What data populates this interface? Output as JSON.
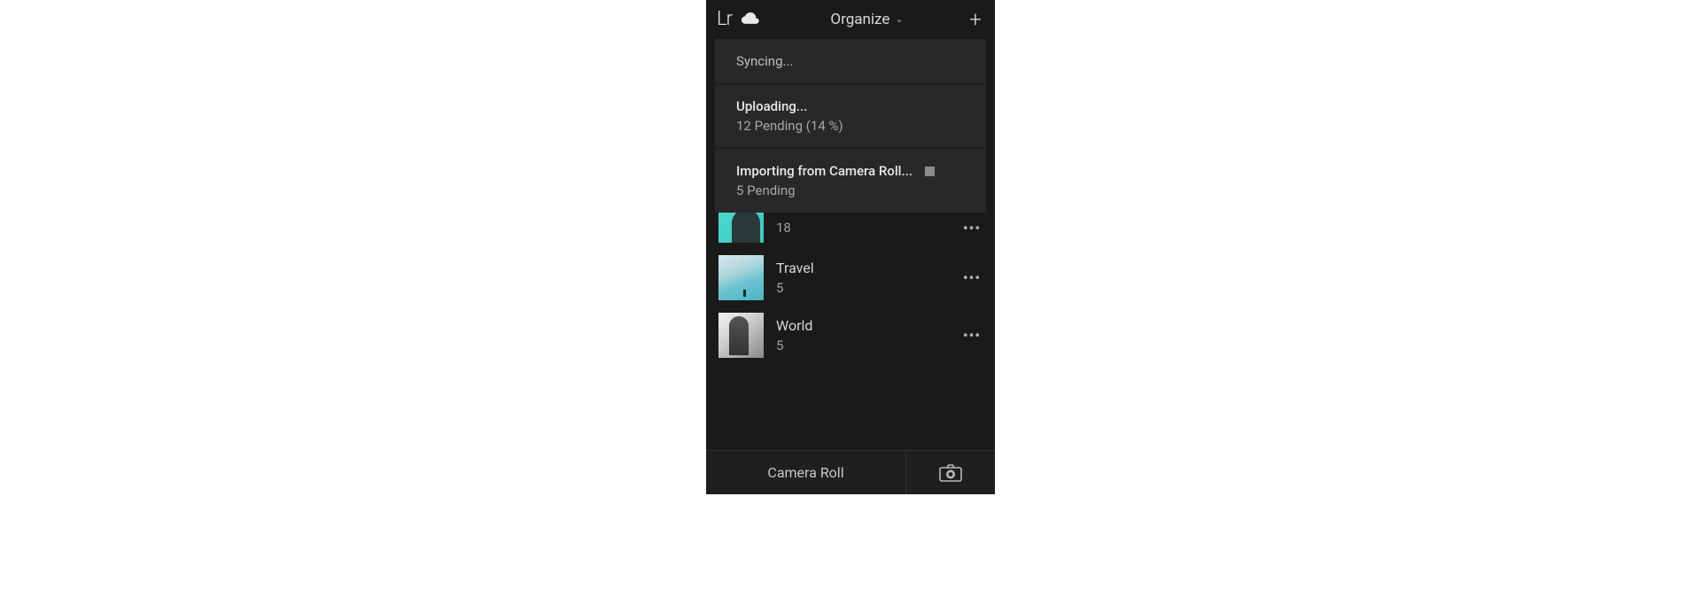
{
  "topbar": {
    "logo_text": "Lr",
    "title": "Organize",
    "plus_label": "+"
  },
  "sync_panel": {
    "syncing_label": "Syncing...",
    "uploading_label": "Uploading...",
    "uploading_sub": "12 Pending  (14 %)",
    "importing_label": "Importing from Camera Roll...",
    "importing_sub": "5 Pending"
  },
  "albums": [
    {
      "name": "",
      "count": "18"
    },
    {
      "name": "Travel",
      "count": "5"
    },
    {
      "name": "World",
      "count": "5"
    }
  ],
  "bottombar": {
    "camera_roll_label": "Camera Roll"
  }
}
